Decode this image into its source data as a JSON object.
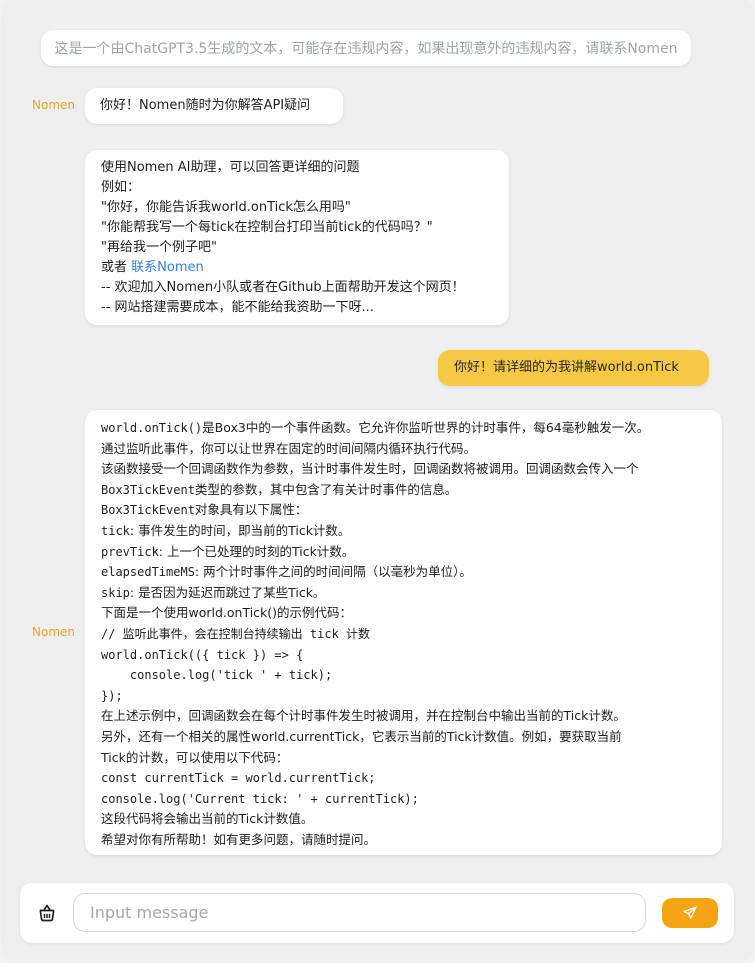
{
  "notice": {
    "text": "这是一个由ChatGPT3.5生成的文本，可能存在违规内容，如果出现意外的违规内容，请联系Nomen"
  },
  "messages": [
    {
      "sender": "Nomen",
      "text": "你好！Nomen随时为你解答API疑问"
    },
    {
      "sender": "",
      "lines": [
        "使用Nomen AI助理，可以回答更详细的问题",
        "例如：",
        "\"你好，你能告诉我world.onTick怎么用吗\"",
        "\"你能帮我写一个每tick在控制台打印当前tick的代码吗？\"",
        "\"再给我一个例子吧\""
      ],
      "contact_prefix": "或者 ",
      "contact_link": "联系Nomen",
      "footer_lines": [
        "-- 欢迎加入Nomen小队或者在Github上面帮助开发这个网页！",
        "-- 网站搭建需要成本，能不能给我资助一下呀..."
      ]
    },
    {
      "sender": "",
      "text": "你好！请详细的为我讲解world.onTick"
    },
    {
      "sender": "Nomen",
      "lines": [
        {
          "mono": "world.onTick()",
          "text": "是Box3中的一个事件函数。它允许你监听世界的计时事件，每64毫秒触发一次。"
        },
        {
          "mono": "",
          "text": "通过监听此事件，你可以让世界在固定的时间间隔内循环执行代码。"
        },
        {
          "mono": "",
          "text": "该函数接受一个回调函数作为参数，当计时事件发生时，回调函数将被调用。回调函数会传入一个"
        },
        {
          "mono": "Box3TickEvent",
          "text": "类型的参数，其中包含了有关计时事件的信息。"
        },
        {
          "mono": "Box3TickEvent",
          "text": "对象具有以下属性："
        },
        {
          "mono": "tick",
          "text": ": 事件发生的时间，即当前的Tick计数。"
        },
        {
          "mono": "prevTick",
          "text": ": 上一个已处理的时刻的Tick计数。"
        },
        {
          "mono": "elapsedTimeMS",
          "text": ": 两个计时事件之间的时间间隔（以毫秒为单位）。"
        },
        {
          "mono": "skip",
          "text": ": 是否因为延迟而跳过了某些Tick。"
        },
        {
          "mono": "",
          "text": "下面是一个使用world.onTick()的示例代码："
        },
        {
          "code": "// 监听此事件，会在控制台持续输出 tick 计数"
        },
        {
          "code": "world.onTick(({ tick }) => {"
        },
        {
          "code": "    console.log('tick ' + tick);"
        },
        {
          "code": "});"
        },
        {
          "mono": "",
          "text": "在上述示例中，回调函数会在每个计时事件发生时被调用，并在控制台中输出当前的Tick计数。"
        },
        {
          "mono": "",
          "text": "另外，还有一个相关的属性world.currentTick，它表示当前的Tick计数值。例如，要获取当前"
        },
        {
          "mono": "",
          "text": "Tick的计数，可以使用以下代码："
        },
        {
          "code": "const currentTick = world.currentTick;"
        },
        {
          "code": "console.log('Current tick: ' + currentTick);"
        },
        {
          "mono": "",
          "text": "这段代码将会输出当前的Tick计数值。"
        },
        {
          "mono": "",
          "text": "希望对你有所帮助！如有更多问题，请随时提问。"
        }
      ]
    }
  ],
  "input": {
    "placeholder": "Input message",
    "value": ""
  },
  "icons": {
    "clear": "basket-icon",
    "send": "paper-plane-icon"
  },
  "colors": {
    "accent": "#f5a415",
    "user_bubble": "#f8c845",
    "sender": "#f0a11f",
    "link": "#2f7fe8"
  }
}
